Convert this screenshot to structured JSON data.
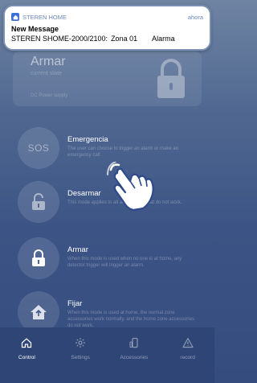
{
  "notification": {
    "app_name": "STEREN HOME",
    "time": "ahora",
    "title": "New Message",
    "device": "STEREN SHOME-2000/2100:",
    "zone": "Zona 01",
    "type": "Alarma"
  },
  "state": {
    "title": "Armar",
    "subtitle": "current state",
    "footer": "DC Power supply"
  },
  "modes": [
    {
      "title": "Emergencia",
      "desc": "The user can choose to trigger an alarm or make an emergency call.",
      "icon": "SOS"
    },
    {
      "title": "Desarmar",
      "desc": "This mode applies to all accessories that do not work."
    },
    {
      "title": "Armar",
      "desc": "When this mode is used when no one is at home, any detector trigger will trigger an alarm."
    },
    {
      "title": "Fijar",
      "desc": "When this mode is used at home, the normal zone accessories work normally, and the home zone accessories do not work."
    }
  ],
  "nav": [
    {
      "label": "Control",
      "icon": "home-icon",
      "active": true
    },
    {
      "label": "Settings",
      "icon": "gear-icon",
      "active": false
    },
    {
      "label": "Accessories",
      "icon": "accessories-icon",
      "active": false
    },
    {
      "label": "record",
      "icon": "warning-icon",
      "active": false
    }
  ],
  "colors": {
    "background_top": "#6f84a3",
    "background_bottom": "#354c7e",
    "nav_bg": "#2f4576",
    "notification_accent": "#6b86b5"
  }
}
